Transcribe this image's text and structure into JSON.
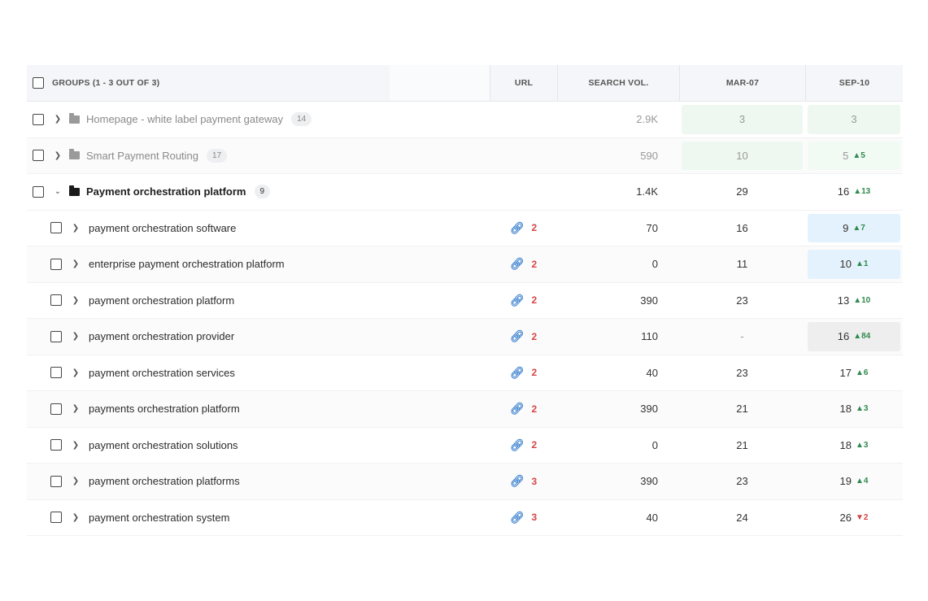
{
  "header": {
    "groups_label": "GROUPS (1 - 3 OUT OF 3)",
    "url": "URL",
    "search_vol": "SEARCH VOL.",
    "date1": "MAR-07",
    "date2": "SEP-10"
  },
  "groups": [
    {
      "name": "Homepage - white label payment gateway",
      "count": "14",
      "vol": "2.9K",
      "mar": "3",
      "sep": "3",
      "sep_delta": ""
    },
    {
      "name": "Smart Payment Routing",
      "count": "17",
      "vol": "590",
      "mar": "10",
      "sep": "5",
      "sep_delta": "5"
    },
    {
      "name": "Payment orchestration platform",
      "count": "9",
      "vol": "1.4K",
      "mar": "29",
      "sep": "16",
      "sep_delta": "13"
    }
  ],
  "keywords": [
    {
      "name": "payment orchestration software",
      "url_count": "2",
      "vol": "70",
      "mar": "16",
      "sep": "9",
      "delta": "7",
      "dir": "up"
    },
    {
      "name": "enterprise payment orchestration platform",
      "url_count": "2",
      "vol": "0",
      "mar": "11",
      "sep": "10",
      "delta": "1",
      "dir": "up"
    },
    {
      "name": "payment orchestration platform",
      "url_count": "2",
      "vol": "390",
      "mar": "23",
      "sep": "13",
      "delta": "10",
      "dir": "up"
    },
    {
      "name": "payment orchestration provider",
      "url_count": "2",
      "vol": "110",
      "mar": "-",
      "sep": "16",
      "delta": "84",
      "dir": "up"
    },
    {
      "name": "payment orchestration services",
      "url_count": "2",
      "vol": "40",
      "mar": "23",
      "sep": "17",
      "delta": "6",
      "dir": "up"
    },
    {
      "name": "payments orchestration platform",
      "url_count": "2",
      "vol": "390",
      "mar": "21",
      "sep": "18",
      "delta": "3",
      "dir": "up"
    },
    {
      "name": "payment orchestration solutions",
      "url_count": "2",
      "vol": "0",
      "mar": "21",
      "sep": "18",
      "delta": "3",
      "dir": "up"
    },
    {
      "name": "payment orchestration platforms",
      "url_count": "3",
      "vol": "390",
      "mar": "23",
      "sep": "19",
      "delta": "4",
      "dir": "up"
    },
    {
      "name": "payment orchestration system",
      "url_count": "3",
      "vol": "40",
      "mar": "24",
      "sep": "26",
      "delta": "2",
      "dir": "down"
    }
  ],
  "icons": {
    "link": "link-icon",
    "folder": "folder-icon",
    "up": "triangle-up-icon",
    "down": "triangle-down-icon"
  },
  "colors": {
    "top3_bg": "#eef8f0",
    "top10_bg": "#e4f2fd",
    "new_bg": "#eeeeee",
    "positive": "#2f8a4d",
    "negative": "#d84040",
    "url_count": "#d64545",
    "link": "#4b8bd2"
  }
}
